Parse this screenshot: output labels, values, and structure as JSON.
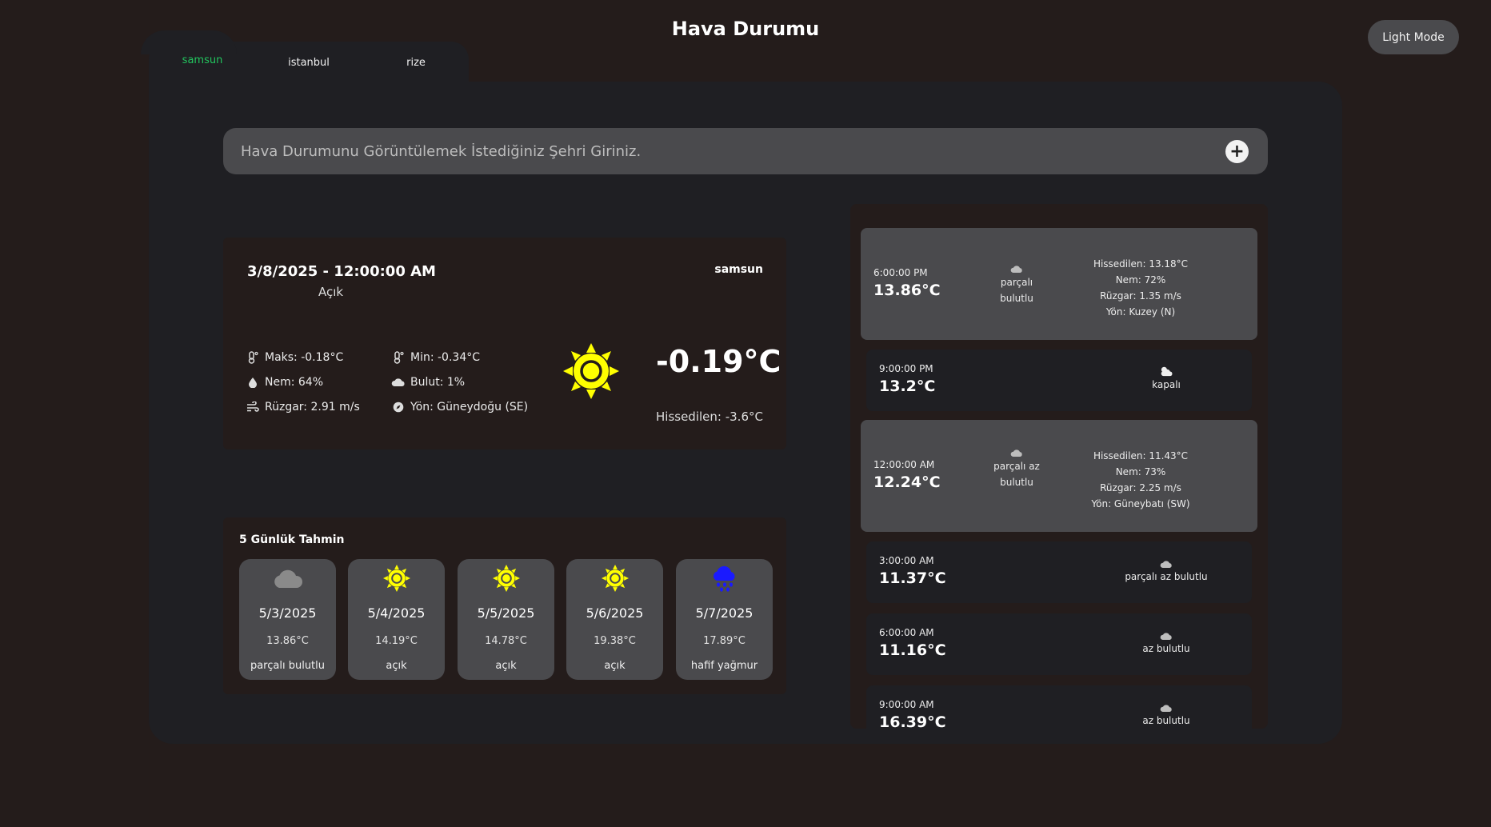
{
  "app": {
    "title": "Hava Durumu",
    "theme_toggle": "Light Mode"
  },
  "tabs": [
    "samsun",
    "istanbul",
    "rize"
  ],
  "search": {
    "placeholder": "Hava Durumunu Görüntülemek İstediğiniz Şehri Giriniz.",
    "add_icon": "plus-icon"
  },
  "current": {
    "datetime": "3/8/2025 - 12:00:00 AM",
    "description": "Açık",
    "city": "samsun",
    "max": "Maks: -0.18°C",
    "min": "Min: -0.34°C",
    "humidity": "Nem: 64%",
    "clouds": "Bulut: 1%",
    "wind": "Rüzgar: 2.91 m/s",
    "direction": "Yön: Güneydoğu (SE)",
    "temp": "-0.19°C",
    "feels_like": "Hissedilen: -3.6°C",
    "icon": "sun-icon",
    "sun_color": "#ffff00"
  },
  "forecast": {
    "title": "5 Günlük Tahmin",
    "days": [
      {
        "date": "5/3/2025",
        "temp": "13.86°C",
        "desc": "parçalı bulutlu",
        "icon": "cloud-icon"
      },
      {
        "date": "5/4/2025",
        "temp": "14.19°C",
        "desc": "açık",
        "icon": "sun-icon"
      },
      {
        "date": "5/5/2025",
        "temp": "14.78°C",
        "desc": "açık",
        "icon": "sun-icon"
      },
      {
        "date": "5/6/2025",
        "temp": "19.38°C",
        "desc": "açık",
        "icon": "sun-icon"
      },
      {
        "date": "5/7/2025",
        "temp": "17.89°C",
        "desc": "hafif yağmur",
        "icon": "rain-icon"
      }
    ]
  },
  "hourly": [
    {
      "time": "6:00:00 PM",
      "temp": "13.86°C",
      "cond": "parçalı bulutlu",
      "feels": "Hissedilen: 13.18°C",
      "humidity": "Nem: 72%",
      "wind": "Rüzgar: 1.35 m/s",
      "dir": "Yön: Kuzey (N)",
      "expanded": true
    },
    {
      "time": "9:00:00 PM",
      "temp": "13.2°C",
      "cond": "kapalı",
      "expanded": false
    },
    {
      "time": "12:00:00 AM",
      "temp": "12.24°C",
      "cond": "parçalı az bulutlu",
      "feels": "Hissedilen: 11.43°C",
      "humidity": "Nem: 73%",
      "wind": "Rüzgar: 2.25 m/s",
      "dir": "Yön: Güneybatı (SW)",
      "expanded": true
    },
    {
      "time": "3:00:00 AM",
      "temp": "11.37°C",
      "cond": "parçalı az bulutlu",
      "expanded": false
    },
    {
      "time": "6:00:00 AM",
      "temp": "11.16°C",
      "cond": "az bulutlu",
      "expanded": false
    },
    {
      "time": "9:00:00 AM",
      "temp": "16.39°C",
      "cond": "az bulutlu",
      "expanded": false
    }
  ],
  "colors": {
    "background": "#241c1b",
    "panel": "#1f1f23",
    "card": "#4a4a4d",
    "active_tab": "#22c55e",
    "sun": "#ffff00",
    "rain": "#1a1aff",
    "cloud": "#8a8a8a"
  }
}
